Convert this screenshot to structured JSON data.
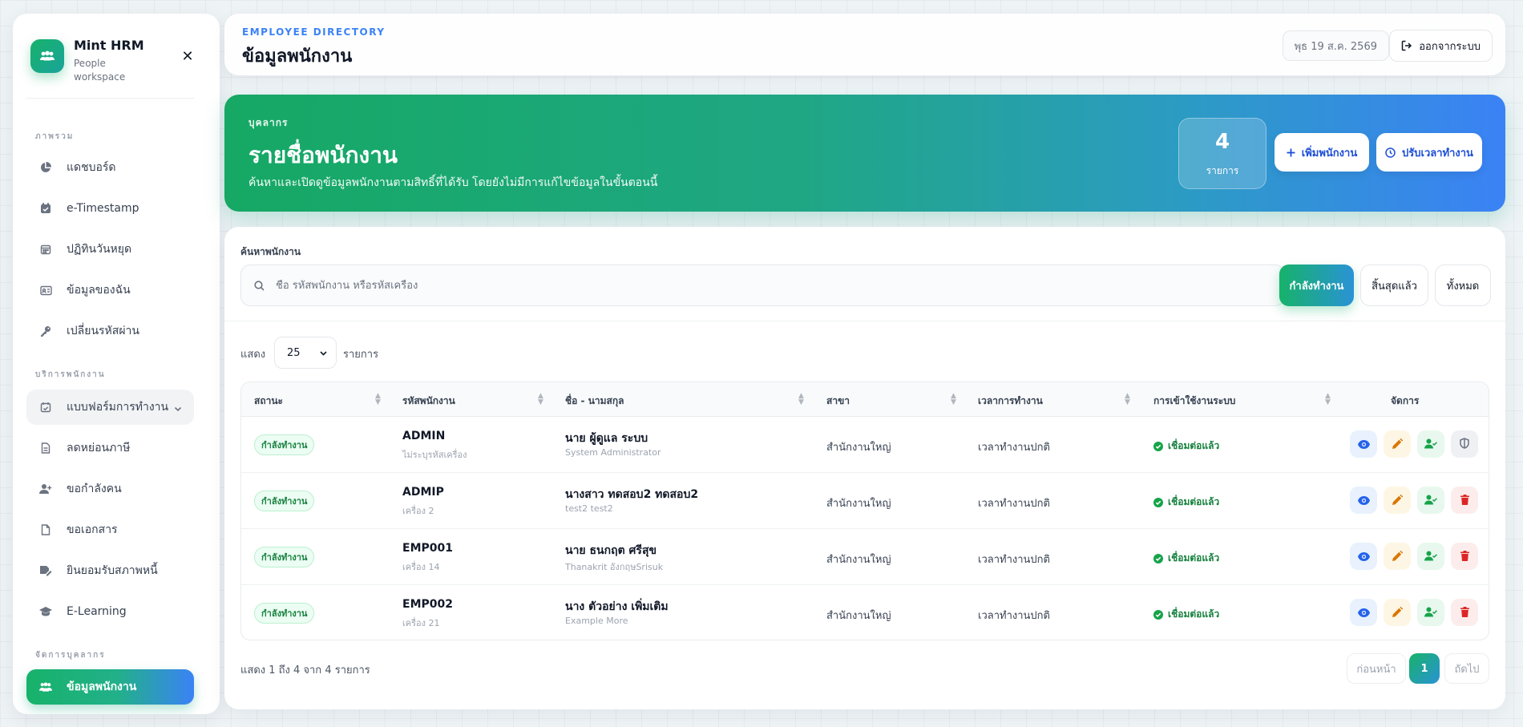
{
  "brand": {
    "name": "Mint HRM",
    "subtitle": "People workspace"
  },
  "sidebar": {
    "sections": [
      {
        "label": "ภาพรวม"
      },
      {
        "label": "บริการพนักงาน"
      },
      {
        "label": "จัดการบุคลากร"
      }
    ],
    "items": [
      {
        "label": "แดชบอร์ด",
        "icon": "pie-chart-icon"
      },
      {
        "label": "e-Timestamp",
        "icon": "calendar-check-icon"
      },
      {
        "label": "ปฏิทินวันหยุด",
        "icon": "calendar-icon"
      },
      {
        "label": "ข้อมูลของฉัน",
        "icon": "id-card-icon"
      },
      {
        "label": "เปลี่ยนรหัสผ่าน",
        "icon": "key-icon"
      },
      {
        "label": "แบบฟอร์มการทำงาน",
        "icon": "calendar-check-icon"
      },
      {
        "label": "ลดหย่อนภาษี",
        "icon": "document-icon"
      },
      {
        "label": "ขอกำลังคน",
        "icon": "user-plus-icon"
      },
      {
        "label": "ขอเอกสาร",
        "icon": "file-icon"
      },
      {
        "label": "ยินยอมรับสภาพหนี้",
        "icon": "signature-icon"
      },
      {
        "label": "E-Learning",
        "icon": "graduation-cap-icon"
      },
      {
        "label": "ข้อมูลพนักงาน",
        "icon": "users-icon"
      }
    ]
  },
  "header": {
    "eyebrow": "EMPLOYEE DIRECTORY",
    "title": "ข้อมูลพนักงาน",
    "date": "พุธ 19 ส.ค. 2569",
    "logout_label": "ออกจากระบบ"
  },
  "hero": {
    "eyebrow": "บุคลากร",
    "title": "รายชื่อพนักงาน",
    "description": "ค้นหาและเปิดดูข้อมูลพนักงานตามสิทธิ์ที่ได้รับ โดยยังไม่มีการแก้ไขข้อมูลในขั้นตอนนี้",
    "count": "4",
    "count_label": "รายการ",
    "add_label": "เพิ่มพนักงาน",
    "adjust_label": "ปรับเวลาทำงาน"
  },
  "search": {
    "label": "ค้นหาพนักงาน",
    "placeholder": "ชื่อ รหัสพนักงาน หรือรหัสเครื่อง",
    "value": ""
  },
  "filters": {
    "active": "กำลังทำงาน",
    "resigned": "สิ้นสุดแล้ว",
    "all": "ทั้งหมด"
  },
  "page_size": {
    "prefix": "แสดง",
    "value": "25",
    "suffix": "รายการ"
  },
  "table": {
    "columns": [
      "สถานะ",
      "รหัสพนักงาน",
      "ชื่อ - นามสกุล",
      "สาขา",
      "เวลาการทำงาน",
      "การเข้าใช้งานระบบ",
      "จัดการ"
    ],
    "rows": [
      {
        "status": "กำลังทำงาน",
        "code": "ADMIN",
        "device": "ไม่ระบุรหัสเครื่อง",
        "name": "นาย ผู้ดูแล ระบบ",
        "name_en": "System Administrator",
        "branch": "สำนักงานใหญ่",
        "shift": "เวลาทำงานปกติ",
        "access": "เชื่อมต่อแล้ว",
        "last_action": "shield"
      },
      {
        "status": "กำลังทำงาน",
        "code": "ADMIP",
        "device": "เครื่อง 2",
        "name": "นางสาว ทดสอบ2 ทดสอบ2",
        "name_en": "test2 test2",
        "branch": "สำนักงานใหญ่",
        "shift": "เวลาทำงานปกติ",
        "access": "เชื่อมต่อแล้ว",
        "last_action": "delete"
      },
      {
        "status": "กำลังทำงาน",
        "code": "EMP001",
        "device": "เครื่อง 14",
        "name": "นาย ธนกฤต ศรีสุข",
        "name_en": "Thanakrit อังกฤษSrisuk",
        "branch": "สำนักงานใหญ่",
        "shift": "เวลาทำงานปกติ",
        "access": "เชื่อมต่อแล้ว",
        "last_action": "delete"
      },
      {
        "status": "กำลังทำงาน",
        "code": "EMP002",
        "device": "เครื่อง 21",
        "name": "นาง ตัวอย่าง เพิ่มเติม",
        "name_en": "Example More",
        "branch": "สำนักงานใหญ่",
        "shift": "เวลาทำงานปกติ",
        "access": "เชื่อมต่อแล้ว",
        "last_action": "delete"
      }
    ]
  },
  "pagination": {
    "info": "แสดง 1 ถึง 4 จาก 4 รายการ",
    "prev": "ก่อนหน้า",
    "current": "1",
    "next": "ถัดไป"
  },
  "colors": {
    "brand_green": "#17b26a",
    "brand_blue": "#3b82f6",
    "success": "#15803d",
    "danger": "#dc2626"
  }
}
